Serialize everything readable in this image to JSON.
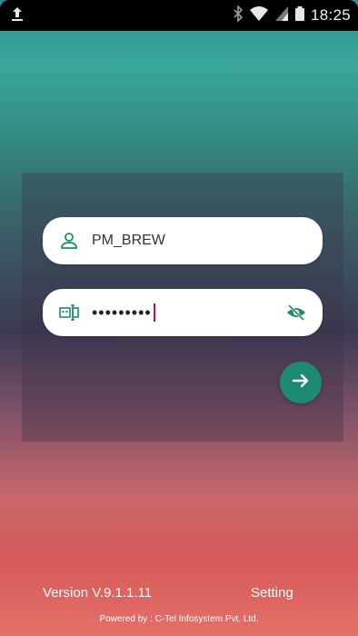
{
  "status_bar": {
    "time": "18:25",
    "icons": [
      "upload-icon",
      "bluetooth-icon",
      "wifi-icon",
      "signal-icon",
      "battery-icon"
    ]
  },
  "login": {
    "username": "PM_BREW",
    "password_mask": "•••••••••",
    "user_icon": "person-icon",
    "password_icon": "password-field-icon",
    "toggle_icon": "eye-off-icon",
    "submit_icon": "arrow-right-icon"
  },
  "footer": {
    "version": "Version V.9.1.1.11",
    "setting": "Setting",
    "powered_by": "Powered by : C-Tel Infosystem Pvt. Ltd."
  },
  "colors": {
    "accent": "#1c8a74",
    "field_bg": "#ffffff",
    "caret": "#c01060"
  }
}
